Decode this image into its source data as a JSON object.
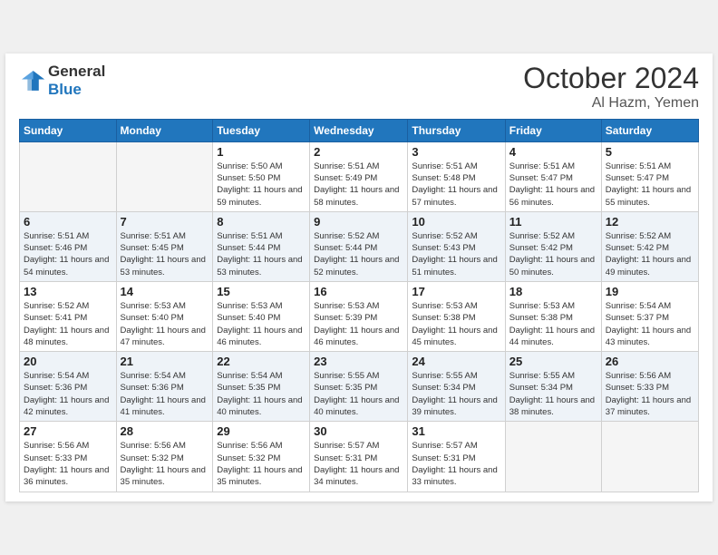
{
  "header": {
    "logo_line1": "General",
    "logo_line2": "Blue",
    "month": "October 2024",
    "location": "Al Hazm, Yemen"
  },
  "weekdays": [
    "Sunday",
    "Monday",
    "Tuesday",
    "Wednesday",
    "Thursday",
    "Friday",
    "Saturday"
  ],
  "weeks": [
    [
      {
        "day": "",
        "sunrise": "",
        "sunset": "",
        "daylight": ""
      },
      {
        "day": "",
        "sunrise": "",
        "sunset": "",
        "daylight": ""
      },
      {
        "day": "1",
        "sunrise": "Sunrise: 5:50 AM",
        "sunset": "Sunset: 5:50 PM",
        "daylight": "Daylight: 11 hours and 59 minutes."
      },
      {
        "day": "2",
        "sunrise": "Sunrise: 5:51 AM",
        "sunset": "Sunset: 5:49 PM",
        "daylight": "Daylight: 11 hours and 58 minutes."
      },
      {
        "day": "3",
        "sunrise": "Sunrise: 5:51 AM",
        "sunset": "Sunset: 5:48 PM",
        "daylight": "Daylight: 11 hours and 57 minutes."
      },
      {
        "day": "4",
        "sunrise": "Sunrise: 5:51 AM",
        "sunset": "Sunset: 5:47 PM",
        "daylight": "Daylight: 11 hours and 56 minutes."
      },
      {
        "day": "5",
        "sunrise": "Sunrise: 5:51 AM",
        "sunset": "Sunset: 5:47 PM",
        "daylight": "Daylight: 11 hours and 55 minutes."
      }
    ],
    [
      {
        "day": "6",
        "sunrise": "Sunrise: 5:51 AM",
        "sunset": "Sunset: 5:46 PM",
        "daylight": "Daylight: 11 hours and 54 minutes."
      },
      {
        "day": "7",
        "sunrise": "Sunrise: 5:51 AM",
        "sunset": "Sunset: 5:45 PM",
        "daylight": "Daylight: 11 hours and 53 minutes."
      },
      {
        "day": "8",
        "sunrise": "Sunrise: 5:51 AM",
        "sunset": "Sunset: 5:44 PM",
        "daylight": "Daylight: 11 hours and 53 minutes."
      },
      {
        "day": "9",
        "sunrise": "Sunrise: 5:52 AM",
        "sunset": "Sunset: 5:44 PM",
        "daylight": "Daylight: 11 hours and 52 minutes."
      },
      {
        "day": "10",
        "sunrise": "Sunrise: 5:52 AM",
        "sunset": "Sunset: 5:43 PM",
        "daylight": "Daylight: 11 hours and 51 minutes."
      },
      {
        "day": "11",
        "sunrise": "Sunrise: 5:52 AM",
        "sunset": "Sunset: 5:42 PM",
        "daylight": "Daylight: 11 hours and 50 minutes."
      },
      {
        "day": "12",
        "sunrise": "Sunrise: 5:52 AM",
        "sunset": "Sunset: 5:42 PM",
        "daylight": "Daylight: 11 hours and 49 minutes."
      }
    ],
    [
      {
        "day": "13",
        "sunrise": "Sunrise: 5:52 AM",
        "sunset": "Sunset: 5:41 PM",
        "daylight": "Daylight: 11 hours and 48 minutes."
      },
      {
        "day": "14",
        "sunrise": "Sunrise: 5:53 AM",
        "sunset": "Sunset: 5:40 PM",
        "daylight": "Daylight: 11 hours and 47 minutes."
      },
      {
        "day": "15",
        "sunrise": "Sunrise: 5:53 AM",
        "sunset": "Sunset: 5:40 PM",
        "daylight": "Daylight: 11 hours and 46 minutes."
      },
      {
        "day": "16",
        "sunrise": "Sunrise: 5:53 AM",
        "sunset": "Sunset: 5:39 PM",
        "daylight": "Daylight: 11 hours and 46 minutes."
      },
      {
        "day": "17",
        "sunrise": "Sunrise: 5:53 AM",
        "sunset": "Sunset: 5:38 PM",
        "daylight": "Daylight: 11 hours and 45 minutes."
      },
      {
        "day": "18",
        "sunrise": "Sunrise: 5:53 AM",
        "sunset": "Sunset: 5:38 PM",
        "daylight": "Daylight: 11 hours and 44 minutes."
      },
      {
        "day": "19",
        "sunrise": "Sunrise: 5:54 AM",
        "sunset": "Sunset: 5:37 PM",
        "daylight": "Daylight: 11 hours and 43 minutes."
      }
    ],
    [
      {
        "day": "20",
        "sunrise": "Sunrise: 5:54 AM",
        "sunset": "Sunset: 5:36 PM",
        "daylight": "Daylight: 11 hours and 42 minutes."
      },
      {
        "day": "21",
        "sunrise": "Sunrise: 5:54 AM",
        "sunset": "Sunset: 5:36 PM",
        "daylight": "Daylight: 11 hours and 41 minutes."
      },
      {
        "day": "22",
        "sunrise": "Sunrise: 5:54 AM",
        "sunset": "Sunset: 5:35 PM",
        "daylight": "Daylight: 11 hours and 40 minutes."
      },
      {
        "day": "23",
        "sunrise": "Sunrise: 5:55 AM",
        "sunset": "Sunset: 5:35 PM",
        "daylight": "Daylight: 11 hours and 40 minutes."
      },
      {
        "day": "24",
        "sunrise": "Sunrise: 5:55 AM",
        "sunset": "Sunset: 5:34 PM",
        "daylight": "Daylight: 11 hours and 39 minutes."
      },
      {
        "day": "25",
        "sunrise": "Sunrise: 5:55 AM",
        "sunset": "Sunset: 5:34 PM",
        "daylight": "Daylight: 11 hours and 38 minutes."
      },
      {
        "day": "26",
        "sunrise": "Sunrise: 5:56 AM",
        "sunset": "Sunset: 5:33 PM",
        "daylight": "Daylight: 11 hours and 37 minutes."
      }
    ],
    [
      {
        "day": "27",
        "sunrise": "Sunrise: 5:56 AM",
        "sunset": "Sunset: 5:33 PM",
        "daylight": "Daylight: 11 hours and 36 minutes."
      },
      {
        "day": "28",
        "sunrise": "Sunrise: 5:56 AM",
        "sunset": "Sunset: 5:32 PM",
        "daylight": "Daylight: 11 hours and 35 minutes."
      },
      {
        "day": "29",
        "sunrise": "Sunrise: 5:56 AM",
        "sunset": "Sunset: 5:32 PM",
        "daylight": "Daylight: 11 hours and 35 minutes."
      },
      {
        "day": "30",
        "sunrise": "Sunrise: 5:57 AM",
        "sunset": "Sunset: 5:31 PM",
        "daylight": "Daylight: 11 hours and 34 minutes."
      },
      {
        "day": "31",
        "sunrise": "Sunrise: 5:57 AM",
        "sunset": "Sunset: 5:31 PM",
        "daylight": "Daylight: 11 hours and 33 minutes."
      },
      {
        "day": "",
        "sunrise": "",
        "sunset": "",
        "daylight": ""
      },
      {
        "day": "",
        "sunrise": "",
        "sunset": "",
        "daylight": ""
      }
    ]
  ]
}
